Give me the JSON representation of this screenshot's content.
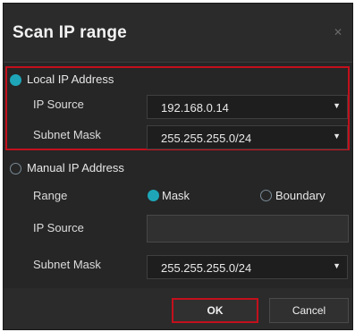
{
  "dialog": {
    "title": "Scan IP range",
    "close_icon": "close-icon"
  },
  "local": {
    "label": "Local IP Address",
    "selected": true,
    "ip_source_label": "IP Source",
    "ip_source_value": "192.168.0.14",
    "subnet_mask_label": "Subnet Mask",
    "subnet_mask_value": "255.255.255.0/24"
  },
  "manual": {
    "label": "Manual IP Address",
    "selected": false,
    "range_label": "Range",
    "range_options": [
      {
        "label": "Mask",
        "selected": true
      },
      {
        "label": "Boundary",
        "selected": false
      }
    ],
    "ip_source_label": "IP Source",
    "ip_source_value": "",
    "subnet_mask_label": "Subnet Mask",
    "subnet_mask_value": "255.255.255.0/24"
  },
  "footer": {
    "ok_label": "OK",
    "cancel_label": "Cancel"
  },
  "colors": {
    "accent": "#1ea6b8",
    "highlight": "#c3101c",
    "background": "#262626"
  }
}
